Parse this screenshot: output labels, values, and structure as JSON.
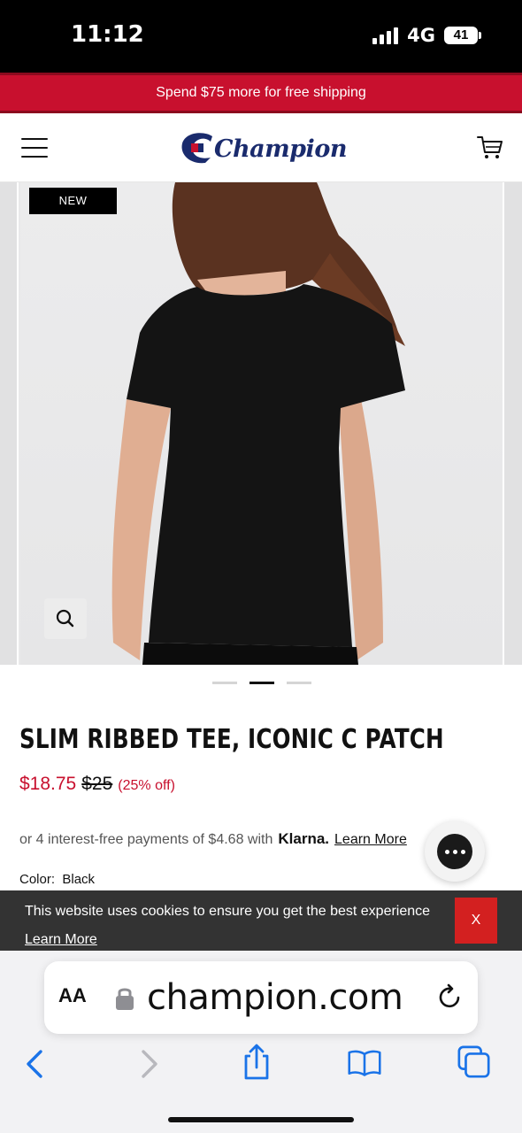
{
  "status": {
    "time": "11:12",
    "network": "4G",
    "battery": "41"
  },
  "promo": {
    "text": "Spend $75 more for free shipping"
  },
  "header": {
    "logo_text": "Champion",
    "menu_icon": "hamburger-menu-icon",
    "cart_icon": "cart-icon"
  },
  "gallery": {
    "badge": "NEW",
    "zoom_icon": "search-icon",
    "dots": 3,
    "active_dot": 1
  },
  "product": {
    "title": "SLIM RIBBED TEE, ICONIC C PATCH",
    "sale_price": "$18.75",
    "original_price": "$25",
    "discount": "(25% off)",
    "klarna_prefix": "or 4 interest-free payments of $4.68 with",
    "klarna_brand": "Klarna.",
    "klarna_link": "Learn More",
    "color_label": "Color:",
    "color_value": "Black"
  },
  "cookie": {
    "text": "This website uses cookies to ensure you get the best experience",
    "link": "Learn More",
    "close": "X"
  },
  "browser": {
    "aa": "AA",
    "url": "champion.com"
  },
  "colors": {
    "brand_red": "#c8102e",
    "brand_navy": "#1a2b6d",
    "cookie_bg": "#333333",
    "cookie_close": "#d32020"
  }
}
